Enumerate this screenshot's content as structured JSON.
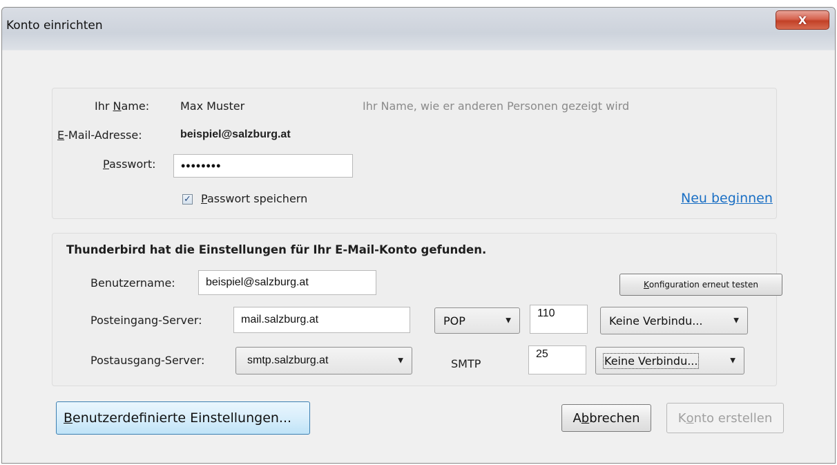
{
  "window": {
    "title": "Konto einrichten",
    "close_label": "X"
  },
  "account": {
    "name_label_pre": "Ihr ",
    "name_label_accel": "N",
    "name_label_post": "ame:",
    "name_value": "Max Muster",
    "name_hint": "Ihr Name, wie er anderen Personen gezeigt wird",
    "email_label_accel": "E",
    "email_label_post": "-Mail-Adresse:",
    "email_value": "beispiel@salzburg.at",
    "password_label_accel": "P",
    "password_label_post": "asswort:",
    "password_value": "••••••••",
    "remember_checked": true,
    "remember_label_accel": "P",
    "remember_label_post": "asswort speichern",
    "restart_link": "Neu beginnen"
  },
  "config": {
    "found_message": "Thunderbird hat die Einstellungen für Ihr E-Mail-Konto gefunden.",
    "username_label": "Benutzername:",
    "username_value": "beispiel@salzburg.at",
    "retest_button_accel": "K",
    "retest_button_post": "onfiguration erneut testen",
    "incoming_label": "Posteingang-Server:",
    "incoming_server": "mail.salzburg.at",
    "incoming_protocol": "POP",
    "incoming_port": "110",
    "incoming_security": "Keine Verbindu...",
    "outgoing_label": "Postausgang-Server:",
    "outgoing_server": "smtp.salzburg.at",
    "outgoing_protocol": "SMTP",
    "outgoing_port": "25",
    "outgoing_security": "Keine Verbindu..."
  },
  "buttons": {
    "advanced_accel": "B",
    "advanced_post": "enutzerdefinierte Einstellungen...",
    "cancel_pre": "A",
    "cancel_accel": "b",
    "cancel_post": "brechen",
    "create_pre": "K",
    "create_accel": "o",
    "create_post": "nto erstellen"
  }
}
